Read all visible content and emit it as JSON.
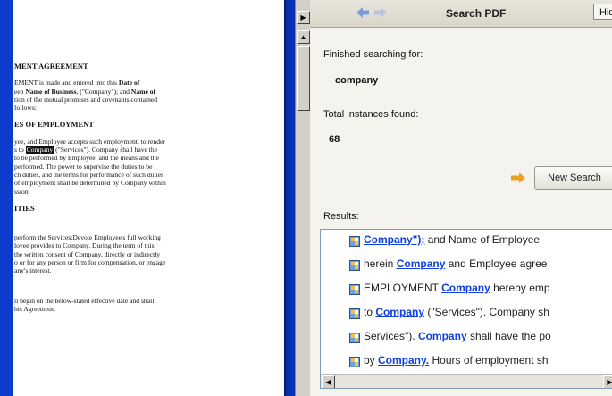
{
  "document": {
    "heading": "MENT AGREEMENT",
    "para1_a": "EMENT is made and entered into this ",
    "para1_b": "Date of",
    "para1_c": "een ",
    "para1_d": "Name of Business",
    "para1_e": ", (\"Company\"); and ",
    "para1_f": "Name of",
    "para1_g": "tion of the mutual promises and covenants contained",
    "para1_h": "follows:",
    "section1": "ES OF EMPLOYMENT",
    "para2_a": "yee, and Employee accepts such employment, to render",
    "para2_b": "s to ",
    "para2_hl": "Company",
    "para2_c": " (\"Services\").  Company shall have the",
    "para2_d": "to be performed by Employee, and the means and the",
    "para2_e": "performed.  The power to supervise the duties to be",
    "para2_f": "ch duties, and the terms for performance of such duties",
    "para2_g": "of employment shall be determined by Company within",
    "para2_h": "ssion.",
    "section2": "ITIES",
    "para3_a": "perform the Services;Devote Employee's full working",
    "para3_b": "loyee provides to Company.  During the term of this",
    "para3_c": "the written consent of Company, directly or indirectly",
    "para3_d": "o or for any person or firm for compensation, or engage",
    "para3_e": "any's interest.",
    "para4_a": "ll begin on the below-stated effective date and shall",
    "para4_b": "his Agreement."
  },
  "panel": {
    "title": "Search PDF",
    "hide_label": "Hide",
    "finished_label": "Finished searching for:",
    "search_term": "company",
    "total_label": "Total instances found:",
    "total_count": "68",
    "new_search_label": "New Search",
    "results_label": "Results:",
    "results": [
      {
        "pre": "",
        "kw": "Company\");",
        "post": " and Name of Employee"
      },
      {
        "pre": "herein ",
        "kw": "Company",
        "post": " and Employee agree"
      },
      {
        "pre": "EMPLOYMENT ",
        "kw": "Company",
        "post": " hereby emp"
      },
      {
        "pre": "to ",
        "kw": "Company",
        "post": " (\"Services\"). Company sh"
      },
      {
        "pre": "Services\"). ",
        "kw": "Company",
        "post": " shall have the po"
      },
      {
        "pre": "by ",
        "kw": "Company.",
        "post": " Hours of employment sh"
      }
    ]
  },
  "colors": {
    "accent": "#1040e0",
    "frame": "#0a2fb0",
    "nav_arrow": "#f0a020"
  }
}
